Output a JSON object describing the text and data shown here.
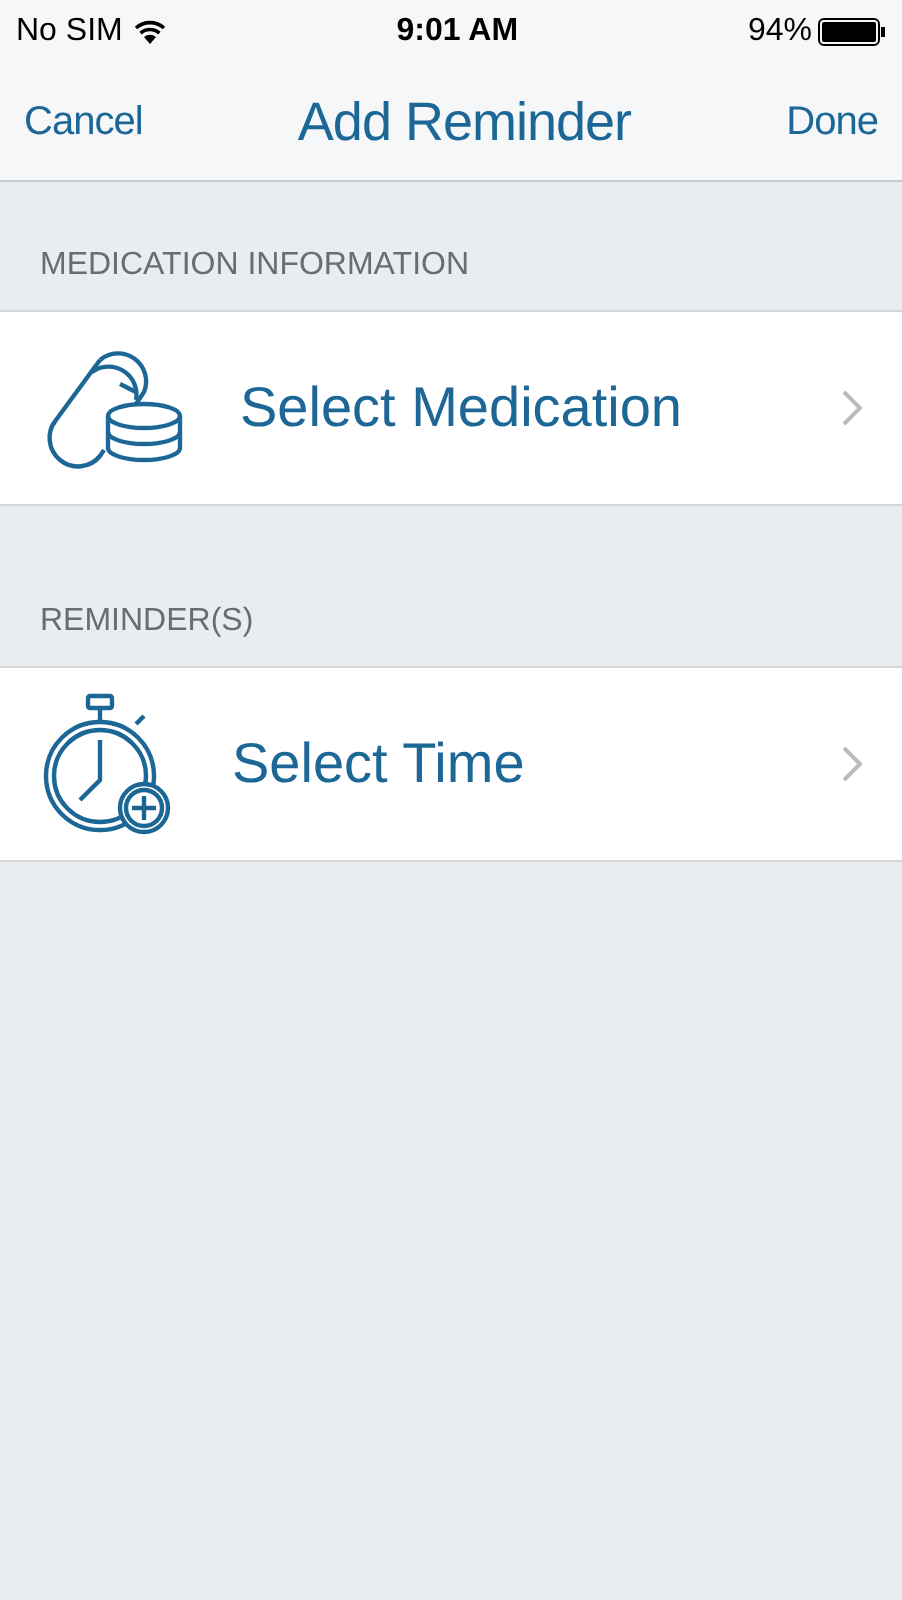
{
  "status_bar": {
    "carrier": "No SIM",
    "time": "9:01 AM",
    "battery": "94%"
  },
  "nav": {
    "cancel": "Cancel",
    "title": "Add Reminder",
    "done": "Done"
  },
  "sections": [
    {
      "header": "MEDICATION INFORMATION",
      "rows": [
        {
          "kind": "medication",
          "label": "Select Medication"
        }
      ]
    },
    {
      "header": "REMINDER(S)",
      "rows": [
        {
          "kind": "time",
          "label": "Select Time"
        }
      ]
    }
  ]
}
